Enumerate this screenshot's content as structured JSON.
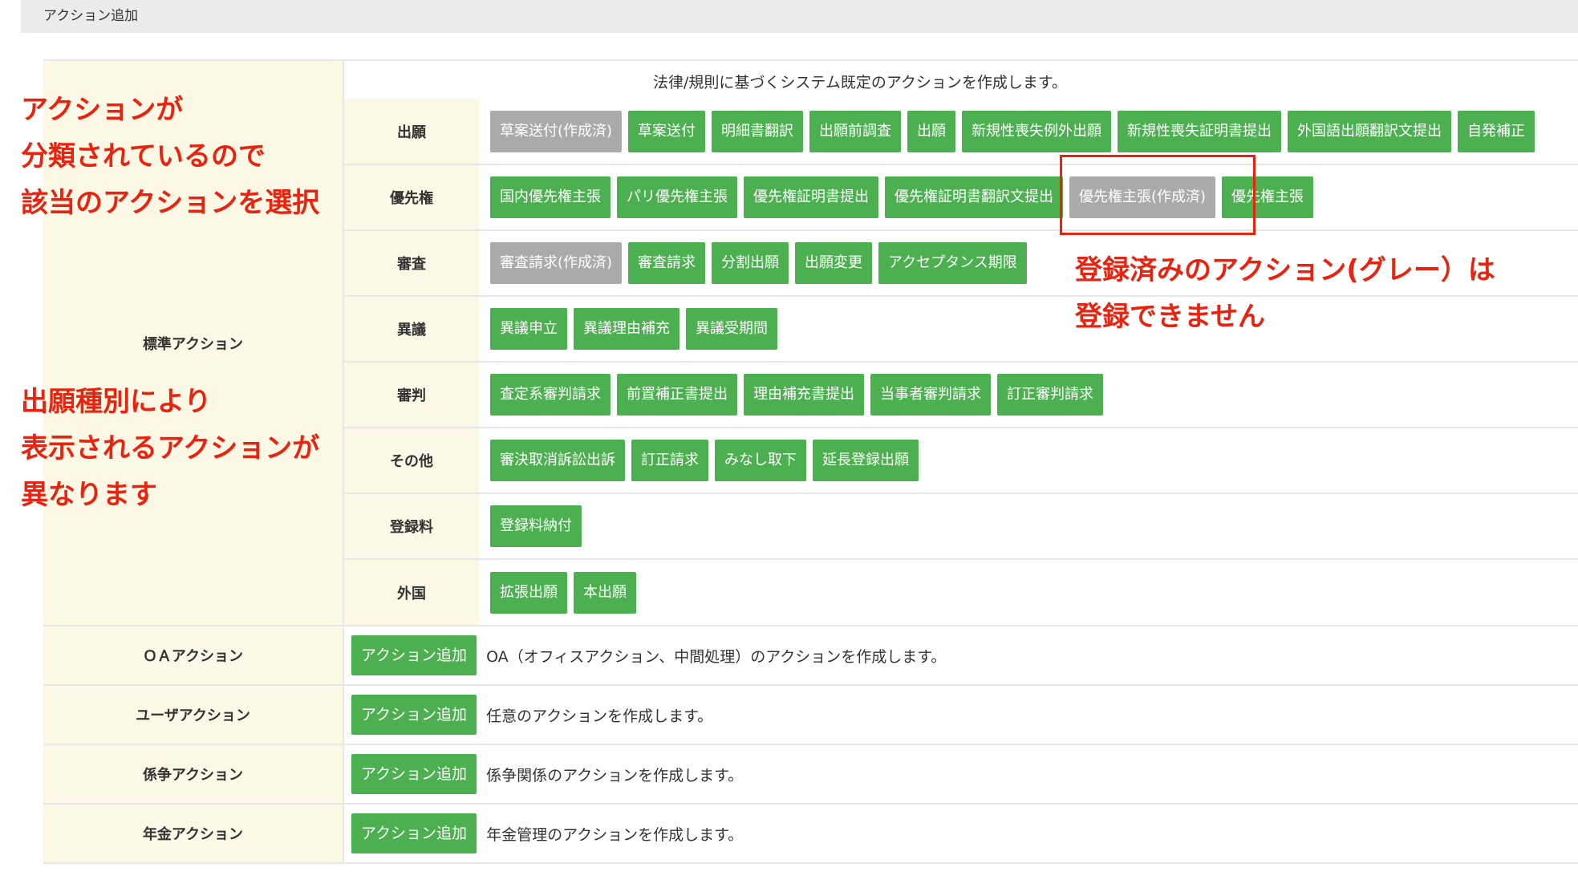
{
  "header": {
    "title": "アクション追加"
  },
  "standard": {
    "label": "標準アクション",
    "description": "法律/規則に基づくシステム既定のアクションを作成します。",
    "categories": [
      {
        "name": "出願",
        "buttons": [
          {
            "label": "草案送付(作成済)",
            "state": "disabled"
          },
          {
            "label": "草案送付",
            "state": "enabled"
          },
          {
            "label": "明細書翻訳",
            "state": "enabled"
          },
          {
            "label": "出願前調査",
            "state": "enabled"
          },
          {
            "label": "出願",
            "state": "enabled"
          },
          {
            "label": "新規性喪失例外出願",
            "state": "enabled"
          },
          {
            "label": "新規性喪失証明書提出",
            "state": "enabled"
          },
          {
            "label": "外国語出願翻訳文提出",
            "state": "enabled"
          },
          {
            "label": "自発補正",
            "state": "enabled"
          }
        ]
      },
      {
        "name": "優先権",
        "buttons": [
          {
            "label": "国内優先権主張",
            "state": "enabled"
          },
          {
            "label": "パリ優先権主張",
            "state": "enabled"
          },
          {
            "label": "優先権証明書提出",
            "state": "enabled"
          },
          {
            "label": "優先権証明書翻訳文提出",
            "state": "enabled"
          },
          {
            "label": "優先権主張(作成済)",
            "state": "disabled"
          },
          {
            "label": "優先権主張",
            "state": "enabled"
          }
        ]
      },
      {
        "name": "審査",
        "buttons": [
          {
            "label": "審査請求(作成済)",
            "state": "disabled"
          },
          {
            "label": "審査請求",
            "state": "enabled"
          },
          {
            "label": "分割出願",
            "state": "enabled"
          },
          {
            "label": "出願変更",
            "state": "enabled"
          },
          {
            "label": "アクセプタンス期限",
            "state": "enabled"
          }
        ]
      },
      {
        "name": "異議",
        "buttons": [
          {
            "label": "異議申立",
            "state": "enabled"
          },
          {
            "label": "異議理由補充",
            "state": "enabled"
          },
          {
            "label": "異議受期間",
            "state": "enabled"
          }
        ]
      },
      {
        "name": "審判",
        "buttons": [
          {
            "label": "査定系審判請求",
            "state": "enabled"
          },
          {
            "label": "前置補正書提出",
            "state": "enabled"
          },
          {
            "label": "理由補充書提出",
            "state": "enabled"
          },
          {
            "label": "当事者審判請求",
            "state": "enabled"
          },
          {
            "label": "訂正審判請求",
            "state": "enabled"
          }
        ]
      },
      {
        "name": "その他",
        "buttons": [
          {
            "label": "審決取消訴訟出訴",
            "state": "enabled"
          },
          {
            "label": "訂正請求",
            "state": "enabled"
          },
          {
            "label": "みなし取下",
            "state": "enabled"
          },
          {
            "label": "延長登録出願",
            "state": "enabled"
          }
        ]
      },
      {
        "name": "登録料",
        "buttons": [
          {
            "label": "登録料納付",
            "state": "enabled"
          }
        ]
      },
      {
        "name": "外国",
        "buttons": [
          {
            "label": "拡張出願",
            "state": "enabled"
          },
          {
            "label": "本出願",
            "state": "enabled"
          }
        ]
      }
    ]
  },
  "action_rows": [
    {
      "label": "ＯＡアクション",
      "button": "アクション追加",
      "description": "OA（オフィスアクション、中間処理）のアクションを作成します。"
    },
    {
      "label": "ユーザアクション",
      "button": "アクション追加",
      "description": "任意のアクションを作成します。"
    },
    {
      "label": "係争アクション",
      "button": "アクション追加",
      "description": "係争関係のアクションを作成します。"
    },
    {
      "label": "年金アクション",
      "button": "アクション追加",
      "description": "年金管理のアクションを作成します。"
    }
  ],
  "annotations": {
    "classified": [
      "アクションが",
      "分類されているので",
      "該当のアクションを選択"
    ],
    "by_type": [
      "出願種別により",
      "表示されるアクションが",
      "異なります"
    ],
    "registered": [
      "登録済みのアクション(グレー）は",
      "登録できません"
    ]
  },
  "colors": {
    "button_green": "#4caf50",
    "button_gray": "#aaaaaa",
    "label_bg": "#fcf8e6",
    "annotation_red": "#e8230f"
  }
}
